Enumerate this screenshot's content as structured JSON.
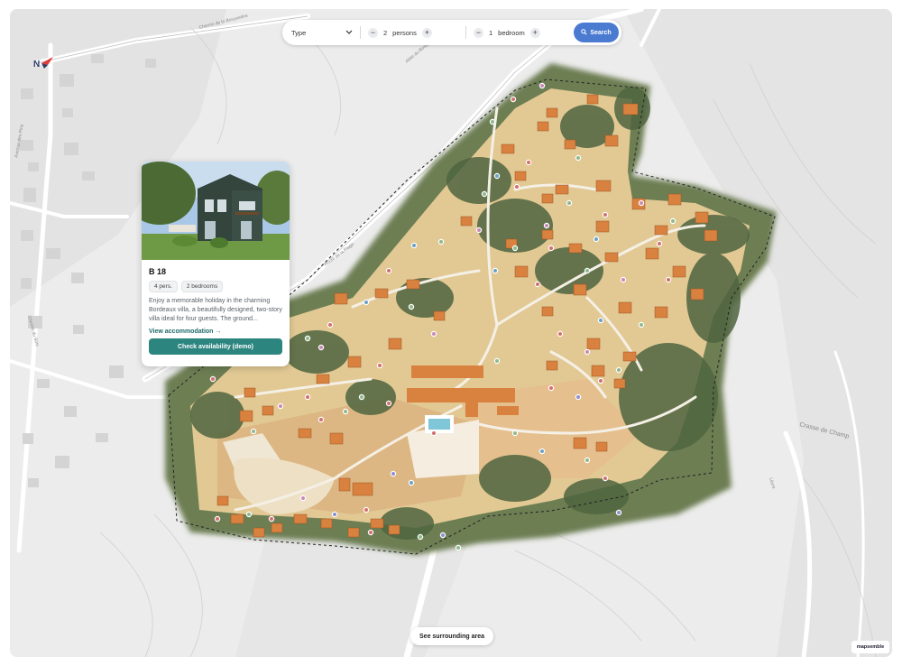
{
  "search": {
    "type_label": "Type",
    "persons_value": "2",
    "persons_label": "persons",
    "bedroom_value": "1",
    "bedroom_label": "bedroom",
    "search_label": "Search",
    "minus_glyph": "−",
    "plus_glyph": "+"
  },
  "card": {
    "title": "B 18",
    "chips": [
      "4 pers.",
      "2 bedrooms"
    ],
    "description": "Enjoy a memorable holiday in the charming Bordeaux villa, a beautifully designed, two-story villa ideal for four guests. The ground...",
    "link_label": "View accommodation →",
    "cta_label": "Check availability (demo)"
  },
  "map": {
    "surrounding_label": "See surrounding area",
    "brand_label": "mapsemble",
    "place_label": "Crasse de Champ",
    "compass_letter": "N",
    "icons": {
      "search": "search-icon",
      "dropdown": "chevron-down-icon",
      "compass": "compass-icon"
    },
    "colors": {
      "primary_button": "#4a7bd1",
      "cta": "#2d8580",
      "house_roof": "#d9813f",
      "forest": "#5d7048",
      "ground": "#e6cf9c"
    }
  }
}
